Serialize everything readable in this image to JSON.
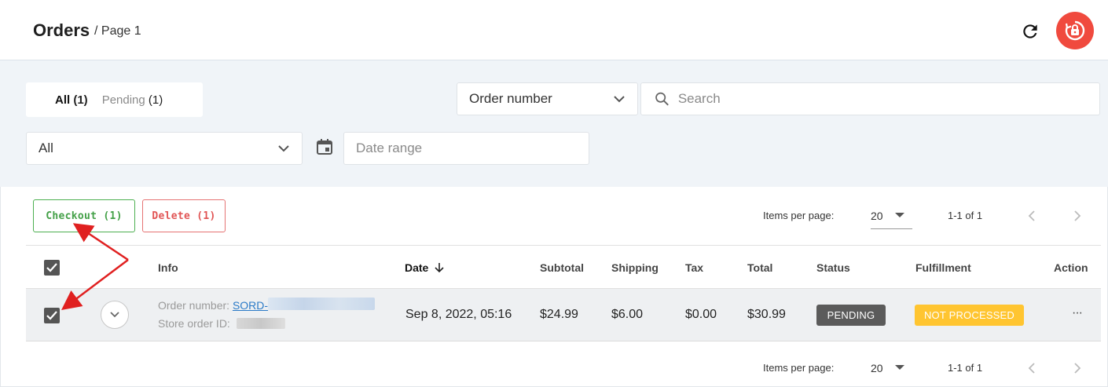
{
  "header": {
    "title": "Orders",
    "subtitle": "/ Page 1"
  },
  "tabs": [
    {
      "label": "All",
      "count": "(1)"
    },
    {
      "label": "Pending",
      "count": "(1)"
    }
  ],
  "filters": {
    "search_field_select": "Order number",
    "search_placeholder": "Search",
    "status_select": "All",
    "date_placeholder": "Date range"
  },
  "actions": {
    "checkout_label": "Checkout (1)",
    "delete_label": "Delete (1)"
  },
  "pagination": {
    "items_per_page_label": "Items per page:",
    "items_per_page_value": "20",
    "range_label": "1-1 of 1"
  },
  "table": {
    "columns": {
      "info": "Info",
      "date": "Date",
      "subtotal": "Subtotal",
      "shipping": "Shipping",
      "tax": "Tax",
      "total": "Total",
      "status": "Status",
      "fulfillment": "Fulfillment",
      "action": "Action"
    },
    "rows": [
      {
        "order_number_label": "Order number:",
        "order_number_value": "SORD-",
        "store_order_label": "Store order ID:",
        "date": "Sep 8, 2022, 05:16",
        "subtotal": "$24.99",
        "shipping": "$6.00",
        "tax": "$0.00",
        "total": "$30.99",
        "status": "PENDING",
        "fulfillment": "NOT PROCESSED",
        "action": "···",
        "checked": true
      }
    ]
  },
  "colors": {
    "accent_red": "#f04a3e",
    "checkout_green": "#43a047",
    "delete_red": "#e15555",
    "pending_badge": "#5b5b5b",
    "not_processed_badge": "#ffc531",
    "annotation_arrow": "#e02020"
  },
  "icons": [
    "refresh-icon",
    "support-lock-icon",
    "chevron-down-icon",
    "search-icon",
    "calendar-icon",
    "arrow-down-icon",
    "chevron-left-icon",
    "chevron-right-icon",
    "checkbox-checked-icon",
    "expand-chevron-icon",
    "more-options-icon"
  ]
}
